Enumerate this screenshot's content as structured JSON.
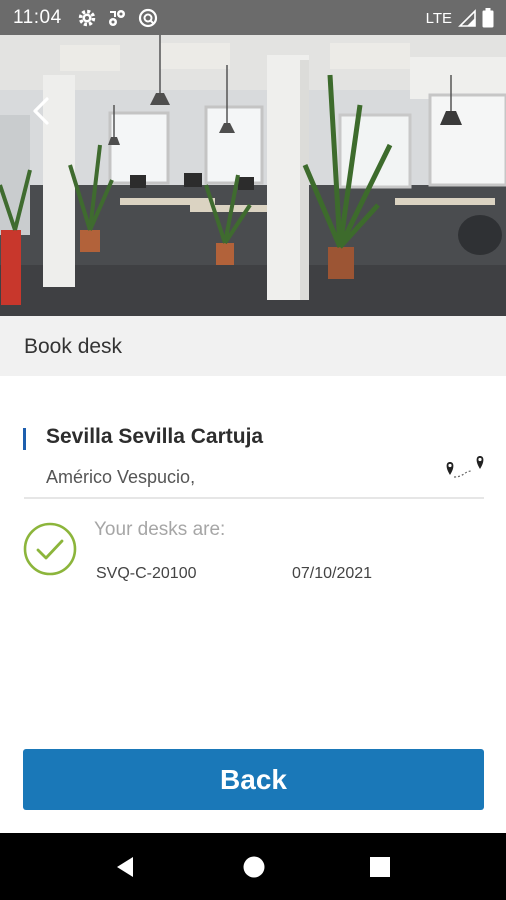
{
  "status_bar": {
    "time": "11:04",
    "network": "LTE",
    "icons": [
      "gear-icon",
      "sync-icon",
      "data-saver-icon",
      "signal-icon",
      "battery-icon"
    ]
  },
  "hero": {
    "image": "open-plan office with desks, columns and potted palms",
    "back_icon": "chevron-left-icon"
  },
  "header": {
    "title": "Book desk"
  },
  "location": {
    "name": "Sevilla Sevilla Cartuja",
    "address": "Américo Vespucio,",
    "map_icon": "route-pins-icon"
  },
  "confirmation": {
    "icon": "check-circle-icon",
    "label": "Your desks are:",
    "desks": [
      {
        "code": "SVQ-C-20100",
        "date": "07/10/2021"
      }
    ]
  },
  "actions": {
    "back_label": "Back"
  },
  "nav": {
    "icons": [
      "back-triangle-icon",
      "home-circle-icon",
      "recents-square-icon"
    ]
  },
  "colors": {
    "status_bar": "#6b6b6b",
    "accent": "#1e5fae",
    "button": "#1a78b8",
    "check": "#8cb53b",
    "header_strip": "#f1f1f1"
  }
}
